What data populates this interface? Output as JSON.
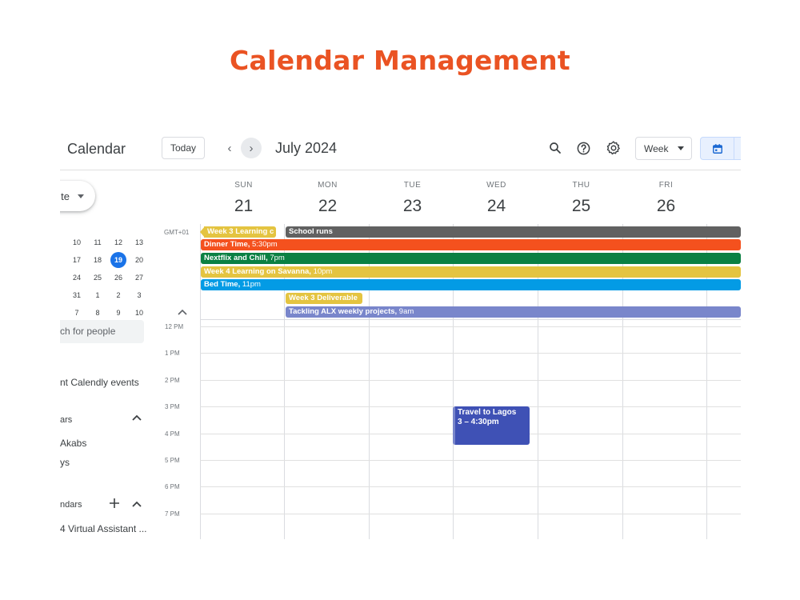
{
  "page": {
    "title": "Calendar  Management"
  },
  "header": {
    "app_name": "Calendar",
    "today_label": "Today",
    "prev_icon": "‹",
    "next_icon": "›",
    "month_title": "July 2024",
    "view_label": "Week"
  },
  "sidebar": {
    "create_label": "te",
    "mini_calendar": {
      "rows": [
        [
          "10",
          "11",
          "12",
          "13"
        ],
        [
          "17",
          "18",
          "19",
          "20"
        ],
        [
          "24",
          "25",
          "26",
          "27"
        ],
        [
          "31",
          "1",
          "2",
          "3"
        ],
        [
          "7",
          "8",
          "9",
          "10"
        ]
      ],
      "today": "19"
    },
    "search_people_placeholder": "ch for people",
    "calendly_label": "nt Calendly events",
    "my_calendars_heading": "ars",
    "my_calendars": [
      "Akabs",
      "ys"
    ],
    "other_calendars_heading": "ndars",
    "other_calendars": [
      "4 Virtual Assistant ..."
    ]
  },
  "week": {
    "timezone": "GMT+01",
    "days": [
      {
        "name": "SUN",
        "date": "21"
      },
      {
        "name": "MON",
        "date": "22"
      },
      {
        "name": "TUE",
        "date": "23"
      },
      {
        "name": "WED",
        "date": "24"
      },
      {
        "name": "THU",
        "date": "25"
      },
      {
        "name": "FRI",
        "date": "26"
      }
    ],
    "hours": [
      "12 PM",
      "1 PM",
      "2 PM",
      "3 PM",
      "4 PM",
      "5 PM",
      "6 PM",
      "7 PM"
    ]
  },
  "all_day_events": [
    {
      "title": "Week 3 Learning c",
      "time": "",
      "color": "#e4c441"
    },
    {
      "title": "School runs",
      "time": "",
      "color": "#616161"
    },
    {
      "title": "Dinner Time,",
      "time": " 5:30pm",
      "color": "#f4511e"
    },
    {
      "title": "Nextflix and Chill,",
      "time": " 7pm",
      "color": "#0b8043"
    },
    {
      "title": "Week 4 Learning on Savanna,",
      "time": " 10pm",
      "color": "#e4c441"
    },
    {
      "title": "Bed Time,",
      "time": " 11pm",
      "color": "#039be5"
    },
    {
      "title": "Week 3 Deliverable",
      "time": "",
      "color": "#e4c441"
    },
    {
      "title": "Tackling ALX weekly projects,",
      "time": " 9am",
      "color": "#7986cb"
    }
  ],
  "timed_events": [
    {
      "title": "Travel to Lagos",
      "time": "3 – 4:30pm",
      "color": "#3f51b5"
    }
  ]
}
